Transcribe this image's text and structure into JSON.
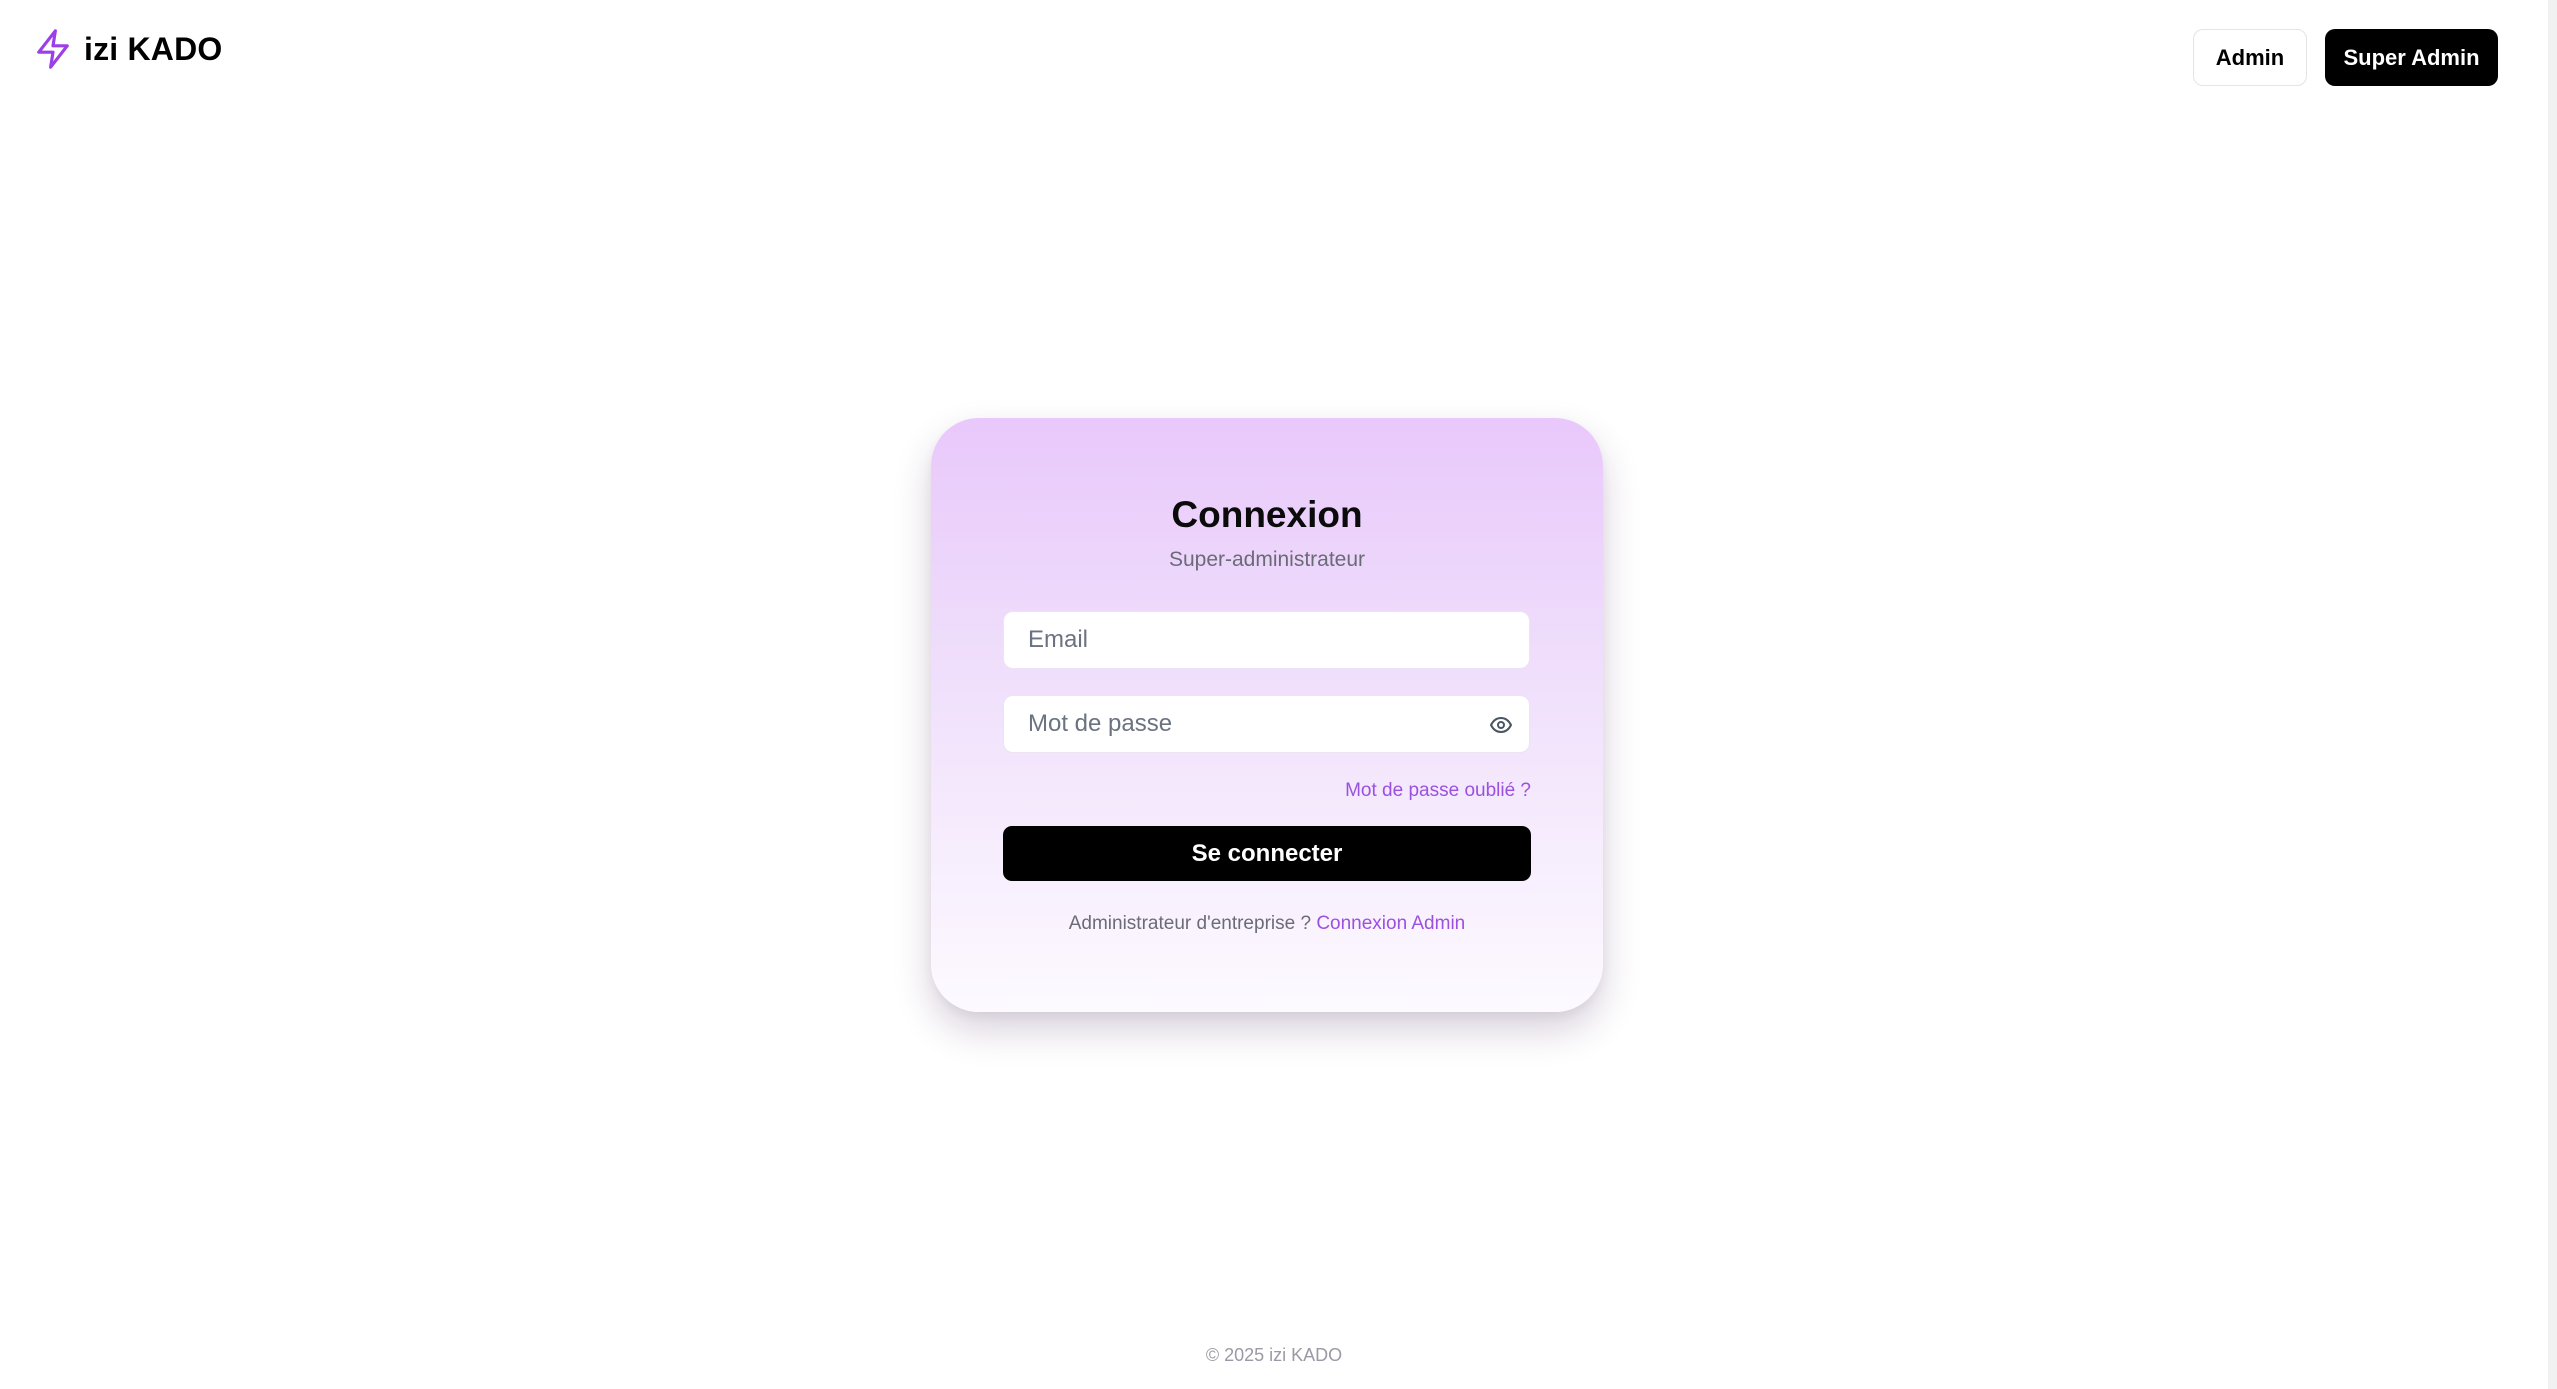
{
  "brand": {
    "name": "izi KADO",
    "icon": "lightning-bolt-icon",
    "icon_color": "#9b3fe8"
  },
  "nav": {
    "admin_label": "Admin",
    "super_admin_label": "Super Admin"
  },
  "login": {
    "title": "Connexion",
    "subtitle": "Super-administrateur",
    "email_placeholder": "Email",
    "email_value": "",
    "password_placeholder": "Mot de passe",
    "password_value": "",
    "password_toggle_icon": "eye-icon",
    "forgot_label": "Mot de passe oublié ?",
    "submit_label": "Se connecter",
    "alt_prompt": "Administrateur d'entreprise ?",
    "alt_link_label": "Connexion Admin"
  },
  "footer": {
    "copyright": "© 2025 izi KADO"
  },
  "colors": {
    "accent": "#9b51e0",
    "primary_button": "#000000",
    "card_gradient_top": "#e9c8fb",
    "card_gradient_bottom": "#fdfaff"
  }
}
